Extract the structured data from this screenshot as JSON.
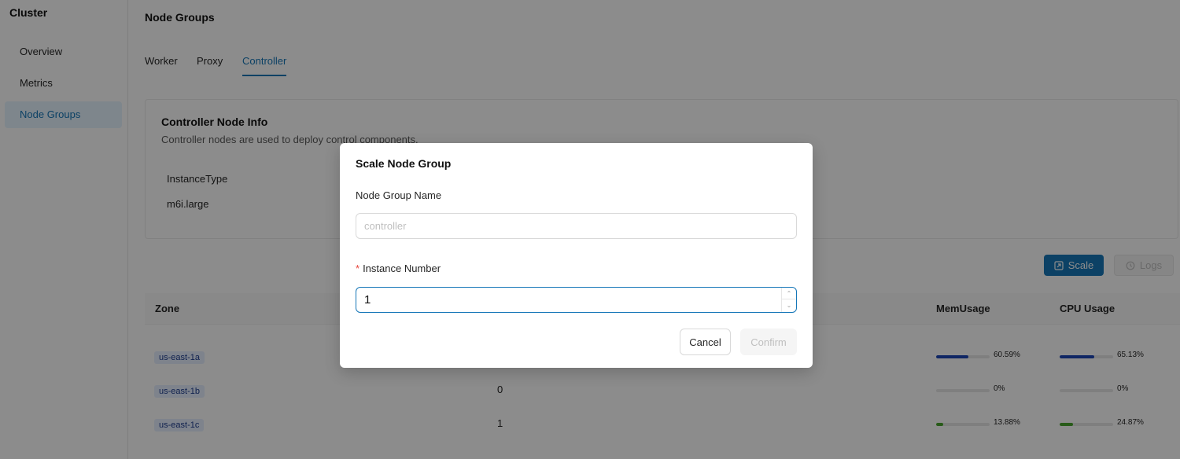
{
  "sidebar": {
    "title": "Cluster",
    "items": [
      {
        "label": "Overview",
        "active": false
      },
      {
        "label": "Metrics",
        "active": false
      },
      {
        "label": "Node Groups",
        "active": true
      }
    ]
  },
  "main": {
    "title": "Node Groups",
    "tabs": [
      {
        "label": "Worker",
        "active": false
      },
      {
        "label": "Proxy",
        "active": false
      },
      {
        "label": "Controller",
        "active": true
      }
    ],
    "info": {
      "title": "Controller Node Info",
      "description": "Controller nodes are used to deploy control components.",
      "field_label": "InstanceType",
      "field_value": "m6i.large"
    },
    "actions": {
      "scale_label": "Scale",
      "logs_label": "Logs",
      "scale_icon": "scale-icon",
      "logs_icon": "history-icon"
    },
    "table": {
      "headers": {
        "zone": "Zone",
        "mem": "MemUsage",
        "cpu": "CPU Usage"
      },
      "rows": [
        {
          "zone": "us-east-1a",
          "count": "",
          "mem": "60.59%",
          "mem_value": 60.59,
          "mem_color": "#1d45b7",
          "cpu": "65.13%",
          "cpu_value": 65.13,
          "cpu_color": "#1d45b7"
        },
        {
          "zone": "us-east-1b",
          "count": "0",
          "mem": "0%",
          "mem_value": 0,
          "mem_color": "#1d45b7",
          "cpu": "0%",
          "cpu_value": 0,
          "cpu_color": "#1d45b7"
        },
        {
          "zone": "us-east-1c",
          "count": "1",
          "mem": "13.88%",
          "mem_value": 13.88,
          "mem_color": "#4aa62f",
          "cpu": "24.87%",
          "cpu_value": 24.87,
          "cpu_color": "#4aa62f"
        }
      ]
    }
  },
  "modal": {
    "title": "Scale Node Group",
    "name_label": "Node Group Name",
    "name_placeholder": "controller",
    "instance_label": "Instance Number",
    "instance_required": "*",
    "instance_value": "1",
    "cancel_label": "Cancel",
    "confirm_label": "Confirm"
  },
  "colors": {
    "accent": "#1677b8",
    "overlay": "rgba(0,0,0,0.45)"
  }
}
